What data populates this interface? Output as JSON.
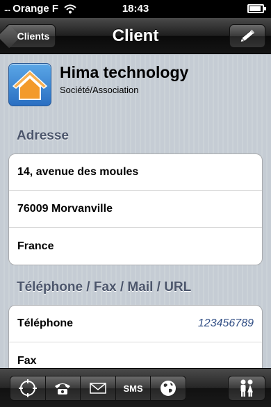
{
  "status_bar": {
    "signal": "....",
    "carrier": "Orange F",
    "time": "18:43"
  },
  "nav": {
    "back_label": "Clients",
    "title": "Client",
    "edit_icon": "pencil-icon"
  },
  "client": {
    "name": "Hima technology",
    "type": "Société/Association",
    "logo_icon": "house-icon"
  },
  "address": {
    "title": "Adresse",
    "lines": [
      "14, avenue des moules",
      "76009 Morvanville",
      "France"
    ]
  },
  "contact": {
    "title": "Téléphone / Fax / Mail / URL",
    "rows": [
      {
        "label": "Téléphone",
        "value": "123456789"
      },
      {
        "label": "Fax",
        "value": ""
      }
    ]
  },
  "toolbar": {
    "items": [
      {
        "icon": "locate-icon"
      },
      {
        "icon": "phone-icon"
      },
      {
        "icon": "mail-icon"
      },
      {
        "label": "SMS"
      },
      {
        "icon": "globe-icon"
      }
    ],
    "contacts_icon": "people-icon"
  },
  "colors": {
    "background": "#c5ccd4",
    "section_title": "#4c566c",
    "link_value": "#324f85"
  }
}
